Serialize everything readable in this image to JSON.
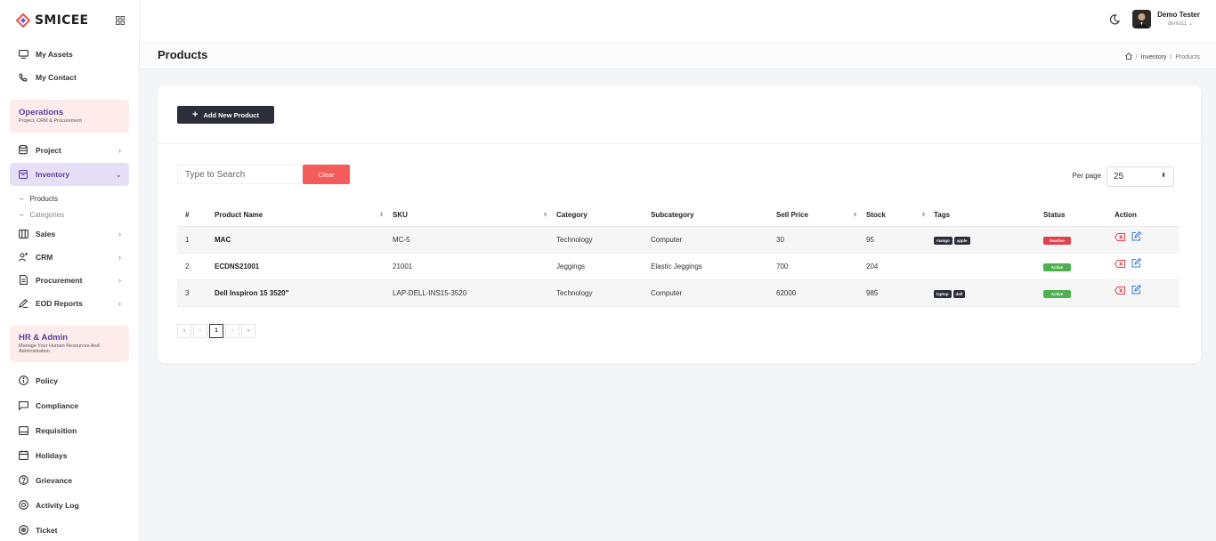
{
  "brand": {
    "name": "SMICEE"
  },
  "colors": {
    "accent": "#5a3e9b",
    "dark_btn": "#2c2f3a",
    "danger": "#f45b5b",
    "active": "#4fb04f",
    "inactive": "#e0414e"
  },
  "sidebar": {
    "top_items": [
      {
        "label": "My Assets",
        "icon": "monitor-icon"
      },
      {
        "label": "My Contact",
        "icon": "phone-icon"
      }
    ],
    "operations": {
      "title": "Operations",
      "subtitle": "Project, CRM & Procurement"
    },
    "project": "Project",
    "inventory": "Inventory",
    "inventory_sub": [
      "Products",
      "Categories"
    ],
    "ops_items": [
      {
        "label": "Sales",
        "icon": "columns-icon"
      },
      {
        "label": "CRM",
        "icon": "users-icon"
      },
      {
        "label": "Procurement",
        "icon": "file-icon"
      },
      {
        "label": "EOD Reports",
        "icon": "pen-icon"
      }
    ],
    "hr": {
      "title": "HR & Admin",
      "subtitle": "Manage Your Human Resources And Administration"
    },
    "hr_items": [
      {
        "label": "Policy",
        "icon": "info-icon"
      },
      {
        "label": "Compliance",
        "icon": "message-icon"
      },
      {
        "label": "Requisition",
        "icon": "clipboard-icon"
      },
      {
        "label": "Holidays",
        "icon": "calendar-icon"
      },
      {
        "label": "Grievance",
        "icon": "help-icon"
      },
      {
        "label": "Activity Log",
        "icon": "target-icon"
      },
      {
        "label": "Ticket",
        "icon": "ticket-icon"
      }
    ]
  },
  "topbar": {
    "user_name": "Demo Tester",
    "user_handle": "demo11 ⌄"
  },
  "page": {
    "title": "Products",
    "breadcrumb": [
      "Inventory",
      "Products"
    ]
  },
  "toolbar": {
    "add_label": "Add New Product",
    "search_placeholder": "Type to Search",
    "clear_label": "Clear",
    "per_page_label": "Per page",
    "per_page_value": "25"
  },
  "table": {
    "headers": [
      "#",
      "Product Name",
      "SKU",
      "Category",
      "Subcategory",
      "Sell Price",
      "Stock",
      "Tags",
      "Status",
      "Action"
    ],
    "rows": [
      {
        "num": "1",
        "name": "MAC",
        "sku": "MC-5",
        "category": "Technology",
        "subcategory": "Computer",
        "price": "30",
        "stock": "95",
        "tags": [
          "mango",
          "apple"
        ],
        "status": "Inactive"
      },
      {
        "num": "2",
        "name": "ECDNS21001",
        "sku": "21001",
        "category": "Jeggings",
        "subcategory": "Elastic Jeggings",
        "price": "700",
        "stock": "204",
        "tags": [],
        "status": "Active"
      },
      {
        "num": "3",
        "name": "Dell Inspiron 15 3520\"",
        "sku": "LAP-DELL-INS15-3520",
        "category": "Technology",
        "subcategory": "Computer",
        "price": "62000",
        "stock": "985",
        "tags": [
          "laptop",
          "dell"
        ],
        "status": "Active"
      }
    ]
  },
  "pagination": {
    "first": "«",
    "prev": "‹",
    "current": "1",
    "next": "›",
    "last": "»"
  }
}
